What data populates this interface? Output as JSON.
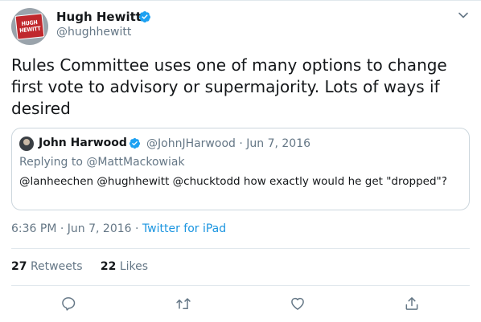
{
  "author": {
    "name": "Hugh Hewitt",
    "handle": "@hughhewitt",
    "avatar_text_line1": "HUGH",
    "avatar_text_line2": "HEWITT"
  },
  "tweet_text": "Rules Committee uses one of many options to change first vote to advisory or supermajority. Lots of ways if desired",
  "quoted": {
    "name": "John Harwood",
    "handle": "@JohnJHarwood",
    "separator": "·",
    "date": "Jun 7, 2016",
    "replying_to": "Replying to @MattMackowiak",
    "text": "@lanheechen @hughhewitt @chucktodd how exactly would he get \"dropped\"?"
  },
  "meta": {
    "time": "6:36 PM",
    "sep1": "·",
    "date": "Jun 7, 2016",
    "sep2": "·",
    "source": "Twitter for iPad"
  },
  "stats": {
    "retweets_count": "27",
    "retweets_label": "Retweets",
    "likes_count": "22",
    "likes_label": "Likes"
  },
  "icons": [
    "verified-badge-icon",
    "chevron-down-icon",
    "reply-icon",
    "retweet-icon",
    "like-icon",
    "share-icon"
  ],
  "colors": {
    "verified": "#1da1f2",
    "link": "#1b95e0",
    "muted": "#657786",
    "text": "#14171a",
    "border": "#ccd6dd"
  }
}
